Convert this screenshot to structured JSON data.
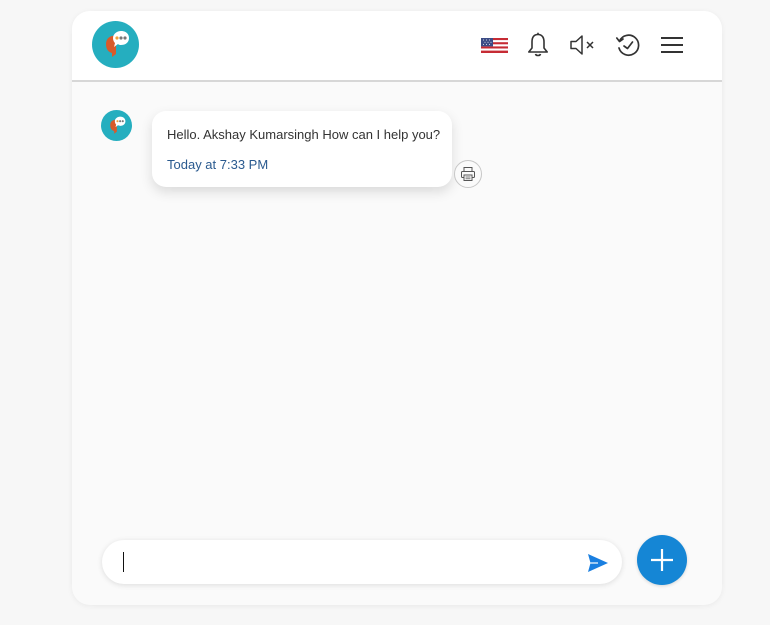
{
  "header": {
    "logo_icon": "chat-bubble-logo-icon",
    "language_icon": "us-flag-icon",
    "notifications_icon": "bell-icon",
    "sound_icon": "speaker-muted-icon",
    "history_icon": "history-clock-icon",
    "menu_icon": "hamburger-menu-icon"
  },
  "conversation": {
    "messages": [
      {
        "sender_avatar_icon": "bot-avatar-icon",
        "text": "Hello. Akshay Kumarsingh How can I help you?",
        "time": "Today at 7:33 PM",
        "action_icon": "print-icon"
      }
    ]
  },
  "composer": {
    "input_value": "",
    "placeholder": "",
    "send_icon": "send-arrow-icon",
    "add_icon": "plus-icon"
  },
  "colors": {
    "accent": "#1586d5",
    "send": "#1a7fe0",
    "timestamp": "#2a5a8f",
    "logo_teal": "#25aebf",
    "logo_orange": "#d85a2a"
  }
}
